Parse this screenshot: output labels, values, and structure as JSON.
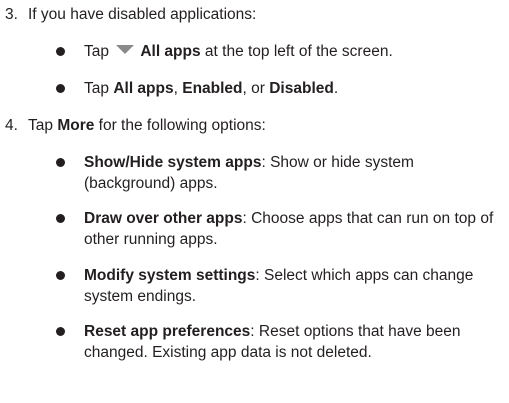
{
  "step3": {
    "number": "3.",
    "text": "If you have disabled applications:",
    "bullets": [
      {
        "pre": "Tap",
        "icon": "dropdown-triangle-icon",
        "bold": "All apps",
        "rest": " at the top left of the screen."
      },
      {
        "pre": "Tap ",
        "b1": "All apps",
        "sep1": ", ",
        "b2": "Enabled",
        "sep2": ", or ",
        "b3": "Disabled",
        "post": "."
      }
    ]
  },
  "step4": {
    "number": "4.",
    "pre": "Tap ",
    "bold": "More",
    "rest": " for the following options:",
    "options": [
      {
        "label": "Show/Hide system apps",
        "desc": ": Show or hide system (background) apps."
      },
      {
        "label": "Draw over other apps",
        "desc": ": Choose apps that can run on top of other running apps."
      },
      {
        "label": "Modify system settings",
        "desc": ": Select which apps can change system endings."
      },
      {
        "label": "Reset app preferences",
        "desc": ": Reset options that have been changed. Existing app data is not deleted."
      }
    ]
  }
}
